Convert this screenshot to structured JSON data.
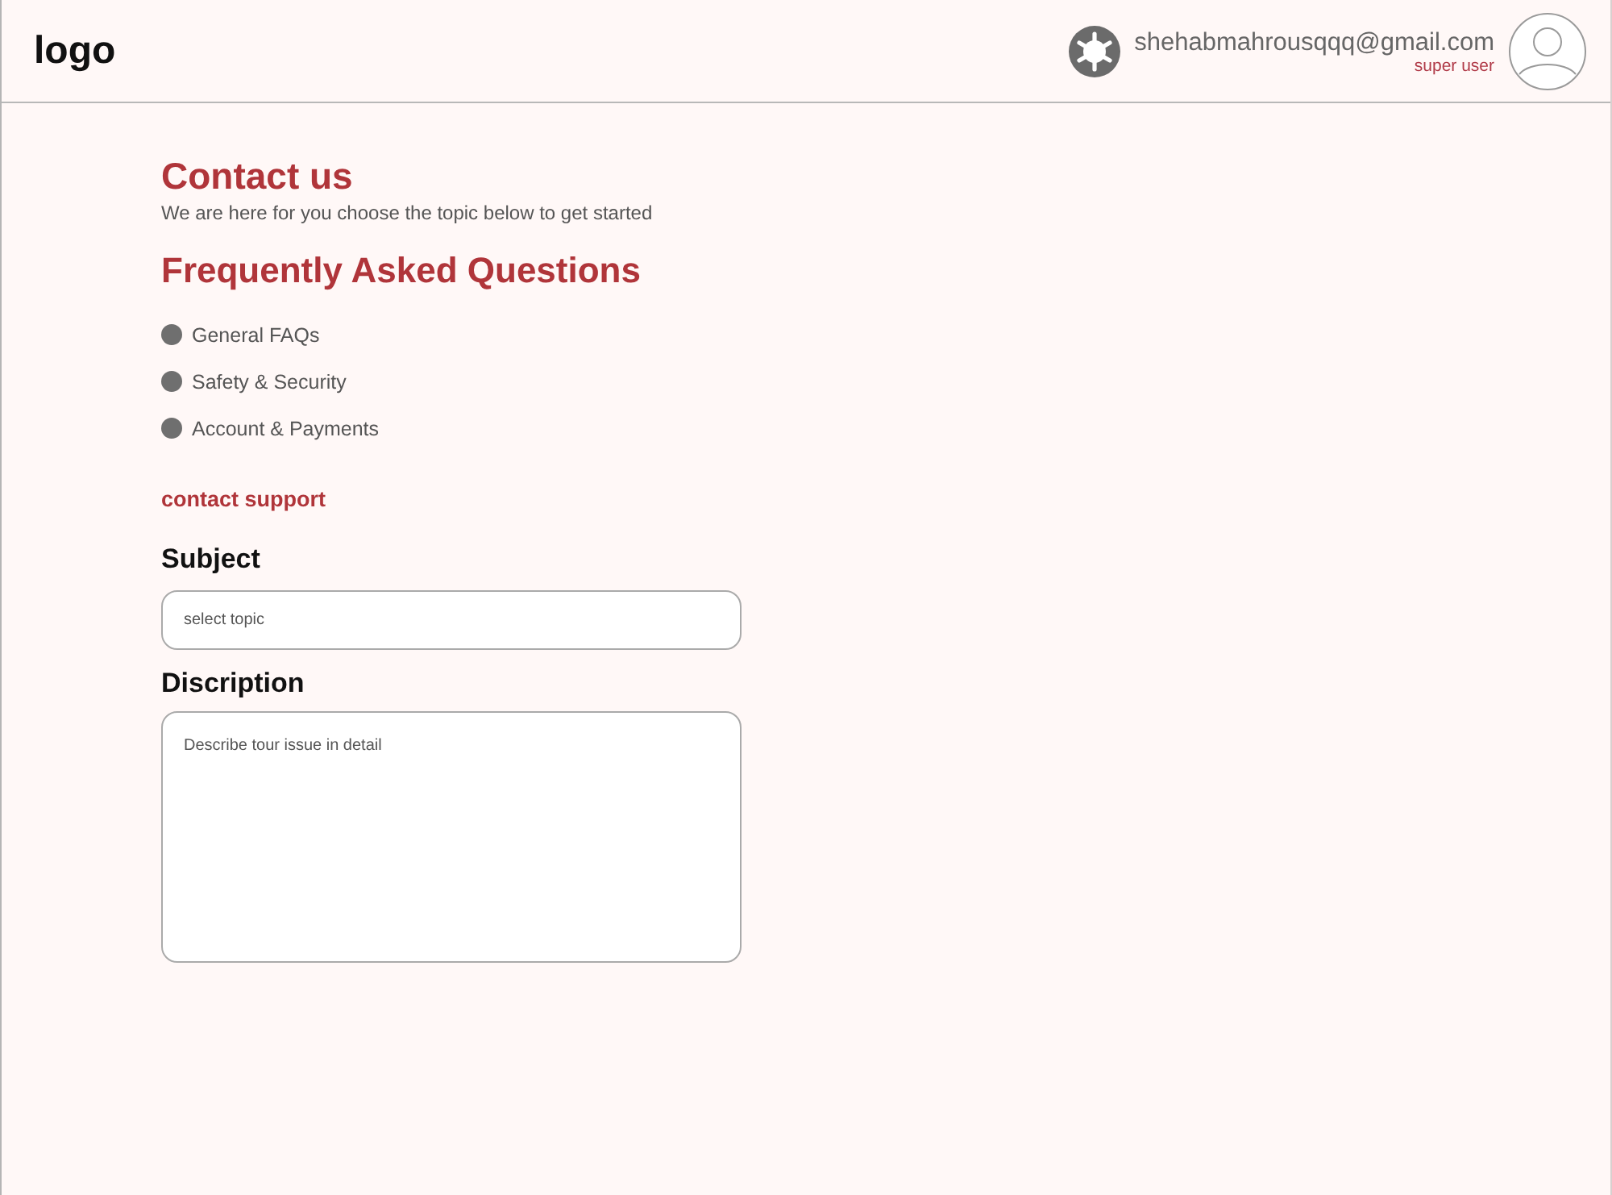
{
  "header": {
    "logo": "logo",
    "user": {
      "email": "shehabmahrousqqq@gmail.com",
      "role": "super user"
    }
  },
  "contact": {
    "title": "Contact us",
    "subtitle": "We are here for you choose the topic below to get started"
  },
  "faq": {
    "title": "Frequently Asked Questions",
    "topics": [
      "General FAQs",
      "Safety & Security",
      "Account & Payments"
    ]
  },
  "support": {
    "title": "contact support",
    "subject": {
      "label": "Subject",
      "placeholder": "select topic"
    },
    "description": {
      "label": "Discription",
      "placeholder": "Describe tour issue in detail"
    }
  }
}
